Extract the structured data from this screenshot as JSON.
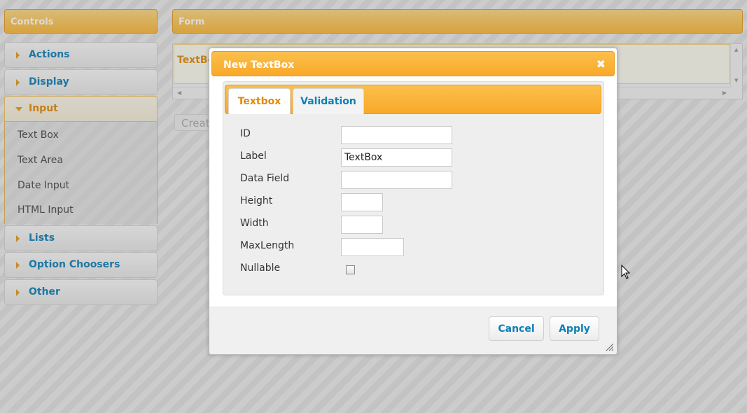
{
  "left_panel": {
    "header": "Controls",
    "sections": [
      {
        "label": "Actions"
      },
      {
        "label": "Display"
      },
      {
        "label": "Input"
      },
      {
        "label": "Lists"
      },
      {
        "label": "Option Choosers"
      },
      {
        "label": "Other"
      }
    ],
    "input_items": [
      "Text Box",
      "Text Area",
      "Date Input",
      "HTML Input"
    ]
  },
  "form_panel": {
    "header": "Form",
    "field_label": "TextBo",
    "create_button": "Creat"
  },
  "dialog": {
    "title": "New TextBox",
    "close_icon": "close-icon",
    "tabs": [
      {
        "label": "Textbox",
        "active": true
      },
      {
        "label": "Validation",
        "active": false
      }
    ],
    "fields": [
      {
        "label": "ID",
        "value": ""
      },
      {
        "label": "Label",
        "value": "TextBox"
      },
      {
        "label": "Data Field",
        "value": ""
      },
      {
        "label": "Height",
        "value": ""
      },
      {
        "label": "Width",
        "value": ""
      },
      {
        "label": "MaxLength",
        "value": ""
      },
      {
        "label": "Nullable",
        "checked": false
      }
    ],
    "buttons": {
      "cancel": "Cancel",
      "apply": "Apply"
    }
  },
  "colors": {
    "accent_orange": "#f9a82a",
    "link_blue": "#0e7fb5",
    "active_text": "#e38a0a"
  }
}
